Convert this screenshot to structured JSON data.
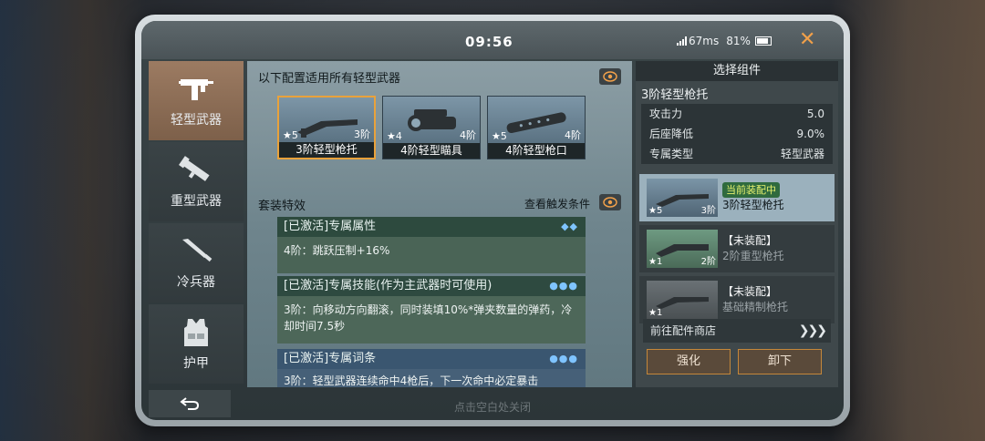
{
  "status": {
    "time": "09:56",
    "ping": "67ms",
    "battery": "81%"
  },
  "sidebar": {
    "items": [
      {
        "label": "轻型武器",
        "icon": "smg-icon",
        "active": true
      },
      {
        "label": "重型武器",
        "icon": "rocket-launcher-icon",
        "active": false
      },
      {
        "label": "冷兵器",
        "icon": "knife-icon",
        "active": false
      },
      {
        "label": "护甲",
        "icon": "armor-vest-icon",
        "active": false
      }
    ]
  },
  "main": {
    "title": "以下配置适用所有轻型武器",
    "slots": [
      {
        "stars": "★5",
        "tier": "3阶",
        "name": "3阶轻型枪托",
        "selected": true
      },
      {
        "stars": "★4",
        "tier": "4阶",
        "name": "4阶轻型瞄具",
        "selected": false
      },
      {
        "stars": "★5",
        "tier": "4阶",
        "name": "4阶轻型枪口",
        "selected": false
      }
    ],
    "set_title": "套装特效",
    "set_condition": "查看触发条件",
    "effects": [
      {
        "header": "[已激活]专属属性",
        "body": "4阶：跳跃压制+16%"
      },
      {
        "header": "[已激活]专属技能(作为主武器时可使用)",
        "body": "3阶：向移动方向翻滚，同时装填10%*弹夹数量的弹药，冷却时间7.5秒"
      },
      {
        "header": "[已激活]专属词条",
        "body": "3阶：轻型武器连续命中4枪后，下一次命中必定暴击"
      }
    ]
  },
  "right": {
    "title": "选择组件",
    "selected_name": "3阶轻型枪托",
    "stats": [
      {
        "label": "攻击力",
        "value": "5.0"
      },
      {
        "label": "后座降低",
        "value": "9.0%"
      },
      {
        "label": "专属类型",
        "value": "轻型武器"
      }
    ],
    "components": [
      {
        "stars": "★5",
        "tier": "3阶",
        "state": "当前装配中",
        "name": "3阶轻型枪托"
      },
      {
        "stars": "★1",
        "tier": "2阶",
        "state": "【未装配】",
        "name": "2阶重型枪托"
      },
      {
        "stars": "★1",
        "tier": "",
        "state": "【未装配】",
        "name": "基础精制枪托"
      }
    ],
    "shop_link": "前往配件商店",
    "enhance": "强化",
    "unequip": "卸下"
  },
  "footer": {
    "hint": "点击空白处关闭"
  },
  "colors": {
    "accent": "#e9a23b",
    "active_tab": "#8c6c54",
    "equipped_badge": "#2f6a3e"
  }
}
